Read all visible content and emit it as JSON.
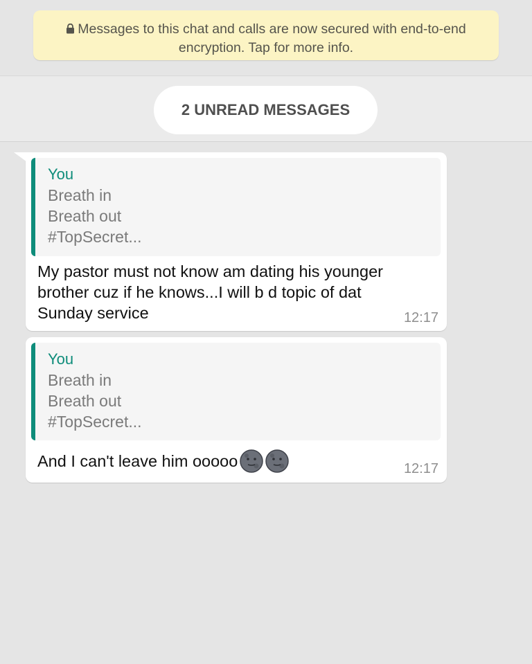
{
  "encryption_notice": {
    "icon": "lock-icon",
    "line1": "Messages to this chat and calls are now secured with end-to-end",
    "line2": "encryption. Tap for more info."
  },
  "unread_banner": {
    "label": "2 UNREAD MESSAGES"
  },
  "messages": [
    {
      "quote": {
        "author": "You",
        "lines": [
          "Breath in",
          "Breath out",
          "#TopSecret..."
        ]
      },
      "text_lines": [
        "My pastor must not know am dating his younger",
        "brother cuz if he knows...I will b d topic of dat",
        "Sunday service"
      ],
      "time": "12:17"
    },
    {
      "quote": {
        "author": "You",
        "lines": [
          "Breath in",
          "Breath out",
          "#TopSecret..."
        ]
      },
      "text": "And I can't leave him ooooo",
      "emoji": [
        "new-moon-face-icon",
        "new-moon-face-icon"
      ],
      "time": "12:17"
    }
  ],
  "colors": {
    "chat_background": "#e5e5e5",
    "notice_background": "#fcf4c4",
    "quote_accent": "#0e8c7a",
    "bubble_background": "#ffffff"
  }
}
